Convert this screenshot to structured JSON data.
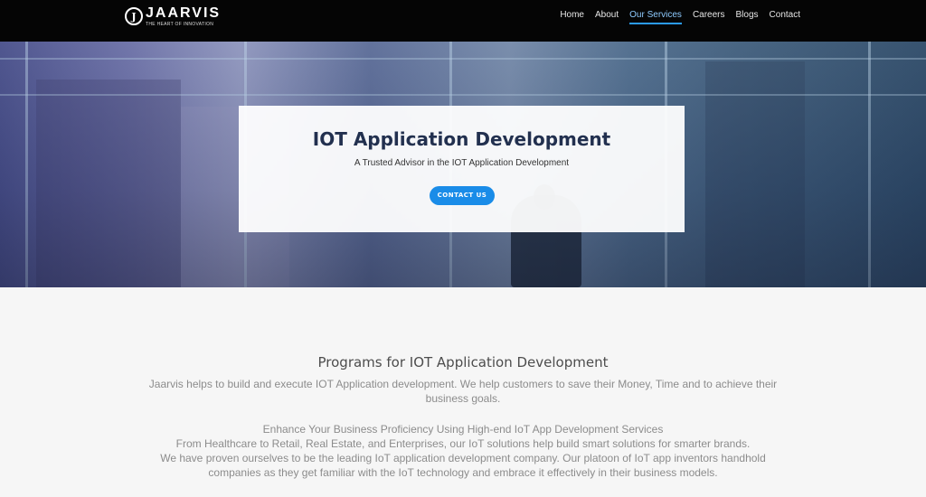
{
  "nav": {
    "logo_letter": "J",
    "logo_name": "JAARVIS",
    "logo_tagline": "THE HEART OF INNOVATION",
    "links": [
      "Home",
      "About",
      "Our Services",
      "Careers",
      "Blogs",
      "Contact"
    ],
    "active_link": "Our Services",
    "accent_color": "#2b9bf4"
  },
  "hero": {
    "title": "IOT Application Development",
    "subtitle": "A Trusted Advisor in the IOT Application Development",
    "cta_label": "CONTACT US",
    "cta_color": "#1a8ce8"
  },
  "section": {
    "title": "Programs for IOT Application Development",
    "intro": "Jaarvis helps to build and execute IOT Application development. We help customers to save their Money, Time and to achieve their business goals.",
    "lines": [
      "Enhance Your Business Proficiency Using High-end IoT App Development Services",
      "From Healthcare to Retail, Real Estate, and Enterprises, our IoT solutions help build smart solutions for smarter brands.",
      "We have proven ourselves to be the leading IoT application development company. Our platoon of IoT app inventors handhold companies as they get familiar with the IoT technology and embrace it effectively in their business models."
    ]
  }
}
